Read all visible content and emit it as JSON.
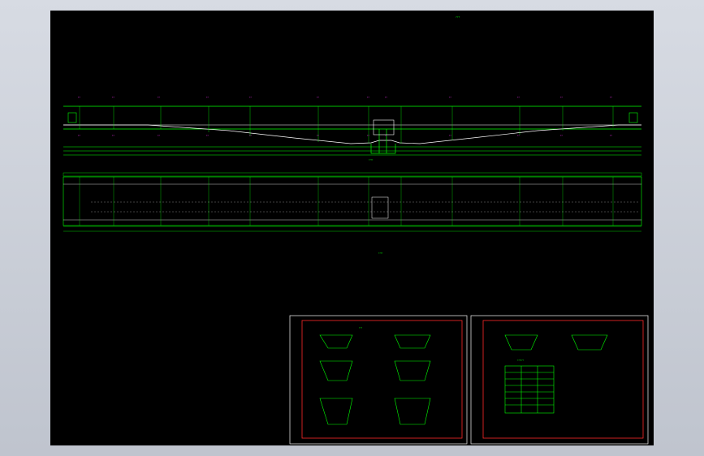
{
  "drawing": {
    "sheet_code": "???",
    "elevation_caption": "????",
    "plan_caption": "????",
    "detail_caption": "???",
    "table_caption": "??????",
    "station_labels": [
      "??",
      "??",
      "??",
      "??",
      "??",
      "??",
      "??",
      "??",
      "??",
      "??",
      "??",
      "??"
    ]
  },
  "colors": {
    "background": "#000000",
    "line_primary": "#00ff00",
    "line_secondary": "#ffffff",
    "line_accent": "#ff33ff",
    "frame": "#ff2a2a",
    "border": "#dddddd"
  }
}
